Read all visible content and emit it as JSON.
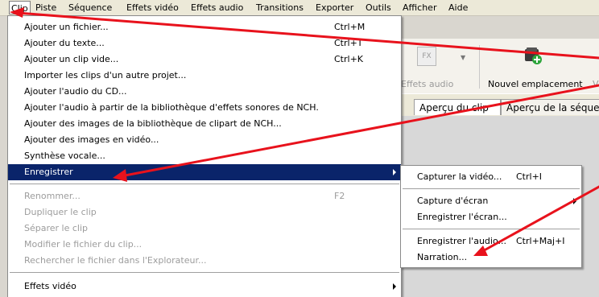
{
  "menubar": {
    "items": [
      "Clip",
      "Piste",
      "Séquence",
      "Effets vidéo",
      "Effets audio",
      "Transitions",
      "Exporter",
      "Outils",
      "Afficher",
      "Aide"
    ]
  },
  "toolbar": {
    "fx_icon": "FX",
    "effets_audio": "Effets audio",
    "nouvel_emplacement": "Nouvel emplacement",
    "cut_label": "Vi"
  },
  "tabs": [
    "Aperçu du clip",
    "Aperçu de la séque"
  ],
  "clip_menu": {
    "items": [
      {
        "label": "Ajouter un fichier...",
        "shortcut": "Ctrl+M"
      },
      {
        "label": "Ajouter du texte...",
        "shortcut": "Ctrl+T"
      },
      {
        "label": "Ajouter un clip vide...",
        "shortcut": "Ctrl+K"
      },
      {
        "label": "Importer les clips d'un autre projet..."
      },
      {
        "label": "Ajouter l'audio du CD..."
      },
      {
        "label": "Ajouter l'audio à partir de la bibliothèque d'effets sonores de NCH."
      },
      {
        "label": "Ajouter des images de la bibliothèque de clipart de NCH..."
      },
      {
        "label": "Ajouter des images en vidéo..."
      },
      {
        "label": "Synthèse vocale..."
      },
      {
        "label": "Enregistrer"
      },
      {
        "label": "Renommer...",
        "shortcut": "F2"
      },
      {
        "label": "Dupliquer le clip"
      },
      {
        "label": "Séparer le clip"
      },
      {
        "label": "Modifier le fichier du clip..."
      },
      {
        "label": "Rechercher le fichier dans l'Explorateur..."
      },
      {
        "label": "Effets vidéo"
      }
    ]
  },
  "record_submenu": {
    "items": [
      {
        "label": "Capturer la vidéo...",
        "shortcut": "Ctrl+I"
      },
      {
        "label": "Capture d'écran"
      },
      {
        "label": "Enregistrer l'écran..."
      },
      {
        "label": "Enregistrer l'audio...",
        "shortcut": "Ctrl+Maj+I"
      },
      {
        "label": "Narration..."
      }
    ]
  },
  "colors": {
    "highlight": "#0a246a",
    "arrow": "#e8121c",
    "disabled": "#9c9c9c"
  }
}
